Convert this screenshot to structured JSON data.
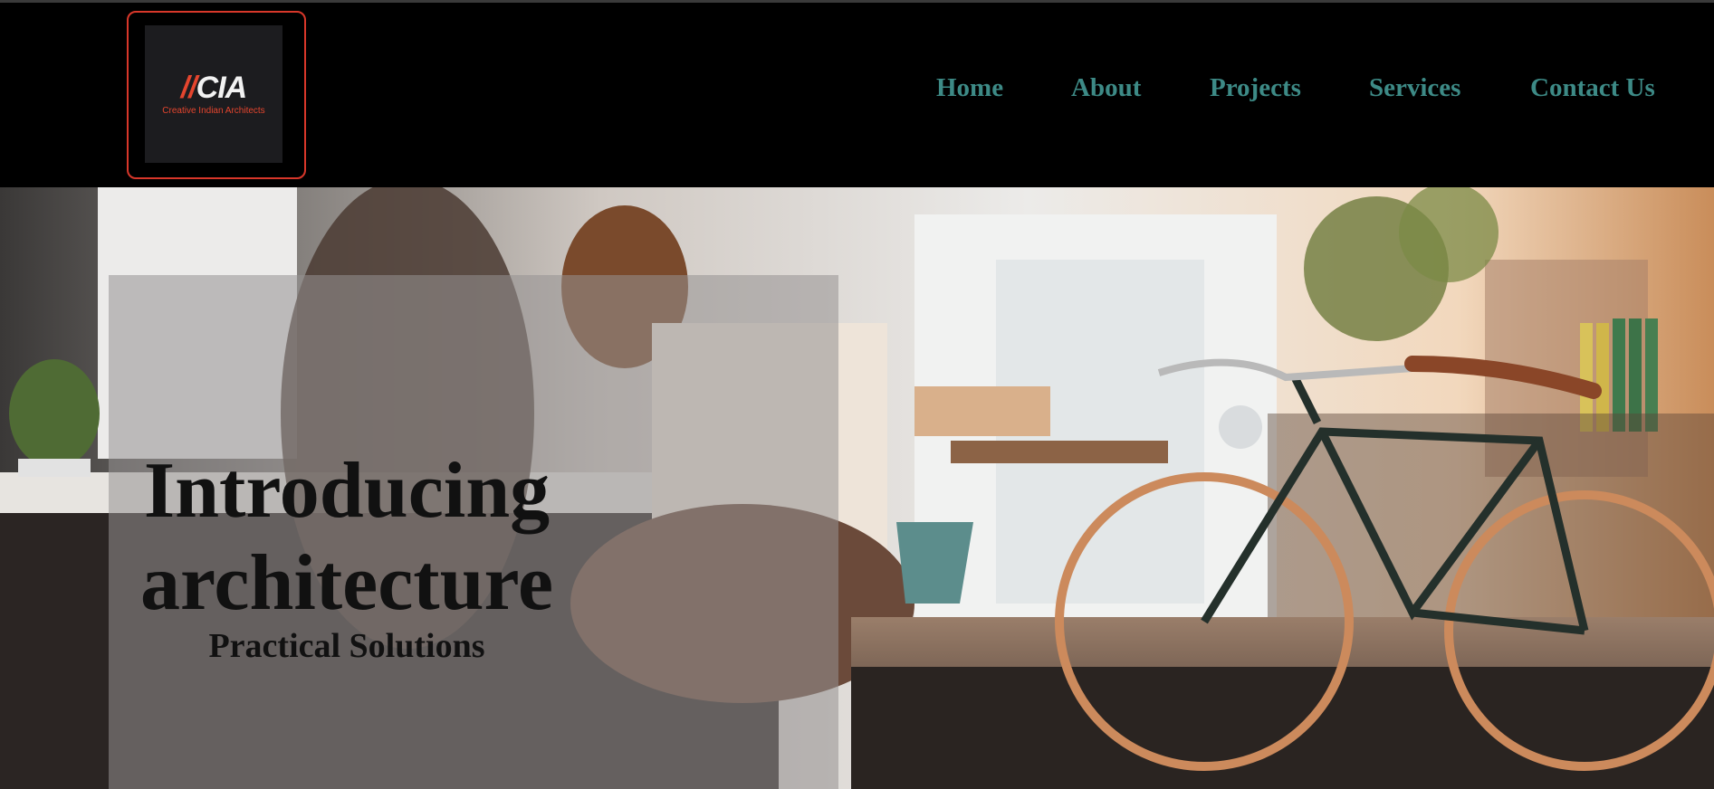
{
  "brand": {
    "slashes": "//",
    "name": "CIA",
    "tagline": "Creative Indian Architects",
    "accent_color": "#e4452e"
  },
  "nav": {
    "items": [
      {
        "label": "Home"
      },
      {
        "label": "About"
      },
      {
        "label": "Projects"
      },
      {
        "label": "Services"
      },
      {
        "label": "Contact Us"
      }
    ],
    "link_color": "#3d8a86"
  },
  "hero": {
    "title_line1": "Introducing",
    "title_line2": "architecture",
    "subtitle": "Practical Solutions",
    "overlay_color": "rgba(150,145,145,0.55)"
  }
}
